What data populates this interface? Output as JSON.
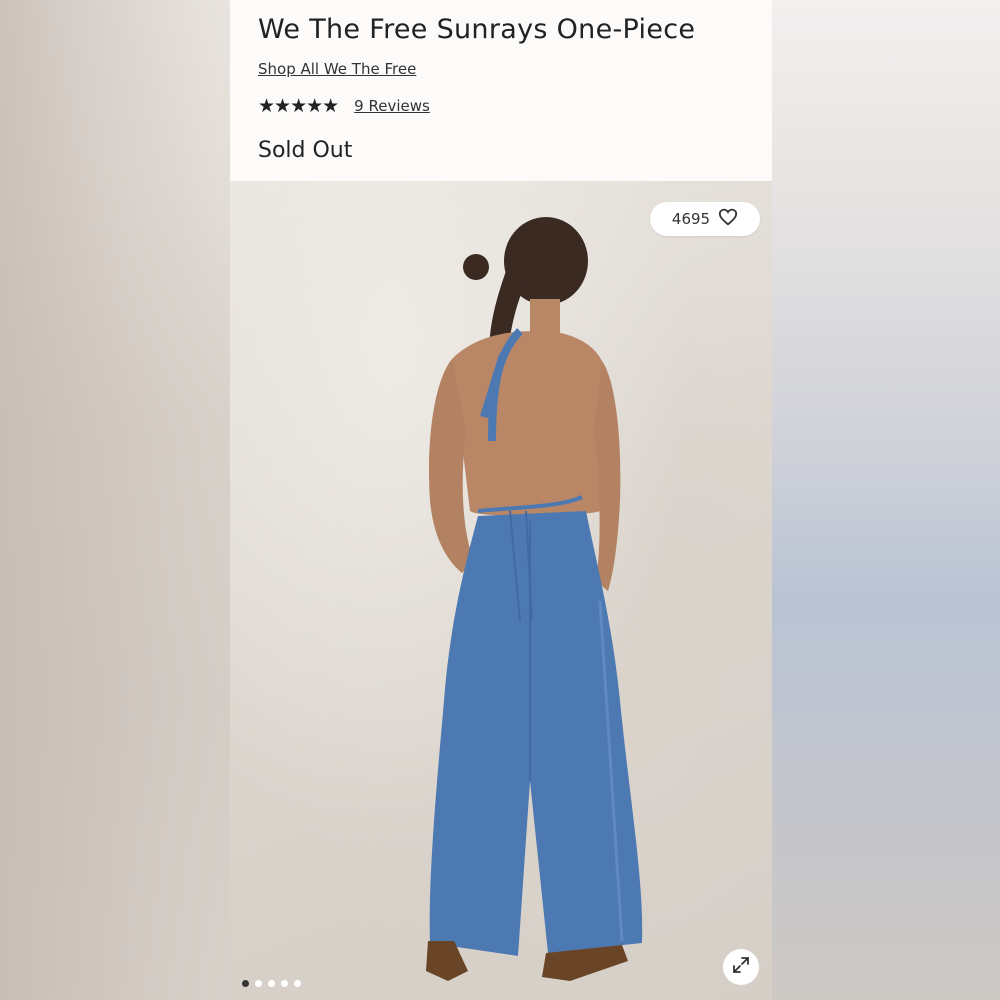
{
  "product": {
    "title": "We The Free Sunrays One-Piece",
    "brand_link": "Shop All We The Free",
    "stars": "★★★★★",
    "reviews_link": "9 Reviews",
    "rating_value": 5,
    "availability": "Sold Out"
  },
  "gallery": {
    "like_count": "4695",
    "like_icon": "heart-outline-icon",
    "expand_icon": "expand-arrows-icon",
    "page_count": 5,
    "current_page": 1
  },
  "colors": {
    "denim": "#4d79b3",
    "text": "#222222",
    "background_header": "#fcfbfa"
  }
}
